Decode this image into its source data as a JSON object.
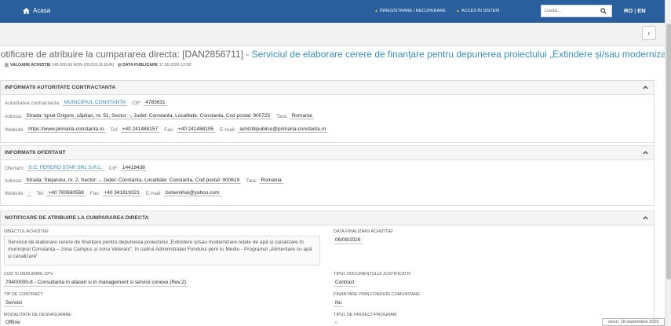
{
  "topbar": {
    "home_label": "Acasa",
    "register_label": "ÎNREGISTRARE / RECUPERARE",
    "login_label": "ACCES ÎN SISTEM",
    "search_placeholder": "Cauta...",
    "lang_ro": "RO",
    "lang_sep": "|",
    "lang_en": "EN",
    "bar_color": "#2a5f9e"
  },
  "subbar": {
    "back_label": "‹"
  },
  "header": {
    "title_prefix": "Notificare de atribuire la cumpararea directa: [DAN2856711]",
    "title_blue": " - Serviciul de elaborare cerere de finanțare pentru depunerea proiectului „Extindere și/sau modernizar...",
    "value_label": "VALOARE ACHIZITIE",
    "value_text": "145.000,00 RON (28.619,36 EUR)",
    "date_label": "DATA PUBLICARE",
    "date_text": "17.09.2026 12:58"
  },
  "authority": {
    "title": "INFORMATII AUTORITATE CONTRACTANTA",
    "org_label": "Autoritatea contractanta:",
    "org_value": "MUNICIPIUL CONSTANTA",
    "cif_label": "CIF:",
    "cif_value": "4785631",
    "address_label": "Adresa:",
    "address_value": "Strada: Ignat Grigore, căpitan, nr. 51, Sector: -, Judet: Constanta, Localitate: Constanta, Cod postal: 900725",
    "country_label": "Tara:",
    "country_value": "Romania",
    "website_label": "Website:",
    "website_value": "https://www.primaria-constanta.ro",
    "tel_label": "Tel:",
    "tel_value": "+40 241488157",
    "fax_label": "Fax:",
    "fax_value": "+40 241488195",
    "email_label": "E-mail:",
    "email_value": "achizitiipublice@primaria-constanta.ro"
  },
  "bidder": {
    "title": "INFORMATII OFERTANT",
    "org_label": "Ofertant:",
    "org_value": "S.C. FERERO STAR SRL S.R.L.",
    "cif_label": "CIF:",
    "cif_value": "14418438",
    "address_label": "Adresa:",
    "address_value": "Strada: Stejarului, nr. 2, Sector: -, Judet: Constanta, Localitate: Constanta, Cod postal: 900619",
    "country_label": "Tara:",
    "country_value": "Romania",
    "website_label": "Website:",
    "website_value": "-",
    "tel_label": "Tel:",
    "tel_value": "+40 760660568",
    "fax_label": "Fax:",
    "fax_value": "+40 341819321",
    "email_label": "E-mail:",
    "email_value": "bobemihai@yahoo.com"
  },
  "notice": {
    "title": "NOTIFICARE DE ATRIBUIRE LA CUMPARAREA DIRECTA",
    "object_label": "OBIECTUL ACHIZITIEI",
    "object_value": "Serviciul de elaborare cerere de finanțare pentru depunerea proiectului „Extindere și/sau modernizare rețele de apă și canalizare în municipiul Constanța – zona Campus și zona Veterani”, în cadrul Administrației Fondului pent ru Mediu - Programul „Alimentare cu apă și canalizare”",
    "finish_date_label": "DATA FINALIZARII ACHIZITIEI",
    "finish_date_value": "06/08/2026",
    "cpv_label": "COD SI DENUMIRE CPV",
    "cpv_value": "79400000-8 - Consultanta in afaceri si in management si servicii conexe (Rev.2)",
    "doc_type_label": "TIPUL DOCUMENTULUI JUSTIFICATIV",
    "doc_type_value": "Contract",
    "contract_type_label": "TIP DE CONTRACT",
    "contract_type_value": "Servicii",
    "eu_funds_label": "FINANTARE PRIN FONDURI COMUNITARE",
    "eu_funds_value": "Nu",
    "modality_label": "MODALITATE DE DESFASURARE",
    "modality_value": "Offline",
    "project_type_label": "TIPUL DE PROIECT/PROGRAM",
    "project_type_value": "-"
  },
  "status": {
    "date_badge": "vineri, 18 septembrie 2026"
  }
}
